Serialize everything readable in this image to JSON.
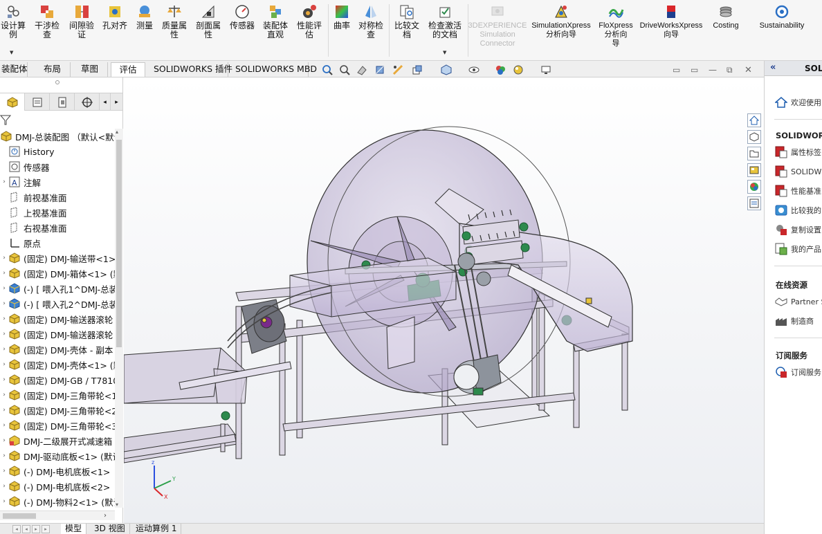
{
  "ribbon": {
    "buttons": [
      {
        "label": "设计算\n例",
        "icon": "design-study-icon"
      },
      {
        "label": "干涉检\n查",
        "icon": "interference-icon"
      },
      {
        "label": "间隙验\n证",
        "icon": "clearance-icon"
      },
      {
        "label": "孔对齐",
        "icon": "hole-align-icon"
      },
      {
        "label": "测量",
        "icon": "measure-icon"
      },
      {
        "label": "质量属\n性",
        "icon": "mass-properties-icon"
      },
      {
        "label": "剖面属\n性",
        "icon": "section-properties-icon"
      },
      {
        "label": "传感器",
        "icon": "sensor-icon"
      },
      {
        "label": "装配体\n直观",
        "icon": "assembly-visualization-icon"
      },
      {
        "label": "性能评\n估",
        "icon": "performance-icon"
      },
      {
        "label": "曲率",
        "icon": "curvature-icon"
      },
      {
        "label": "对称检\n查",
        "icon": "symmetry-icon"
      },
      {
        "label": "比较文\n档",
        "icon": "compare-icon"
      },
      {
        "label": "检查激活\n的文档",
        "icon": "check-active-icon"
      },
      {
        "label": "3DEXPERIENCE\nSimulation\nConnector",
        "icon": "3dexperience-icon"
      },
      {
        "label": "SimulationXpress\n分析向导",
        "icon": "simulationxpress-icon"
      },
      {
        "label": "FloXpress\n分析向\n导",
        "icon": "floxpress-icon"
      },
      {
        "label": "DriveWorksXpress\n向导",
        "icon": "driveworks-icon"
      },
      {
        "label": "Costing",
        "icon": "costing-icon"
      },
      {
        "label": "Sustainability",
        "icon": "sustainability-icon"
      }
    ]
  },
  "tabs": [
    "装配体",
    "布局",
    "草图",
    "评估",
    "SOLIDWORKS 插件",
    "SOLIDWORKS MBD"
  ],
  "active_tab": "评估",
  "tree": {
    "root": "DMJ-总装配图 （默认<默认",
    "items": [
      {
        "label": "History",
        "icon": "history-icon",
        "caret": ""
      },
      {
        "label": "传感器",
        "icon": "sensor-folder-icon",
        "caret": ""
      },
      {
        "label": "注解",
        "icon": "annotation-icon",
        "caret": "›"
      },
      {
        "label": "前视基准面",
        "icon": "plane-icon",
        "caret": ""
      },
      {
        "label": "上视基准面",
        "icon": "plane-icon",
        "caret": ""
      },
      {
        "label": "右视基准面",
        "icon": "plane-icon",
        "caret": ""
      },
      {
        "label": "原点",
        "icon": "origin-icon",
        "caret": ""
      },
      {
        "label": "(固定) DMJ-输送带<1>",
        "icon": "subassembly-icon",
        "caret": "›"
      },
      {
        "label": "(固定) DMJ-箱体<1> (默",
        "icon": "subassembly-icon",
        "caret": "›"
      },
      {
        "label": "(-) [ 喂入孔1^DMJ-总装",
        "icon": "part-icon",
        "caret": "›"
      },
      {
        "label": "(-) [ 喂入孔2^DMJ-总装",
        "icon": "part-icon",
        "caret": "›"
      },
      {
        "label": "(固定) DMJ-输送器滚轮",
        "icon": "subassembly-icon",
        "caret": "›"
      },
      {
        "label": "(固定) DMJ-输送器滚轮",
        "icon": "subassembly-icon",
        "caret": "›"
      },
      {
        "label": "(固定) DMJ-壳体 - 副本",
        "icon": "subassembly-icon",
        "caret": "›"
      },
      {
        "label": "(固定) DMJ-壳体<1> (默",
        "icon": "subassembly-icon",
        "caret": "›"
      },
      {
        "label": "(固定) DMJ-GB / T7810",
        "icon": "subassembly-icon",
        "caret": "›"
      },
      {
        "label": "(固定) DMJ-三角带轮<1",
        "icon": "subassembly-icon",
        "caret": "›"
      },
      {
        "label": "(固定) DMJ-三角带轮<2",
        "icon": "subassembly-icon",
        "caret": "›"
      },
      {
        "label": "(固定) DMJ-三角带轮<3",
        "icon": "subassembly-icon",
        "caret": "›"
      },
      {
        "label": "DMJ-二级展开式减速箱",
        "icon": "assembly-icon",
        "caret": "›"
      },
      {
        "label": "DMJ-驱动底板<1> (默认",
        "icon": "subassembly-icon",
        "caret": "›"
      },
      {
        "label": "(-) DMJ-电机底板<1>",
        "icon": "subassembly-icon",
        "caret": "›"
      },
      {
        "label": "(-) DMJ-电机底板<2>",
        "icon": "subassembly-icon",
        "caret": "›"
      },
      {
        "label": "(-) DMJ-物料2<1> (默认",
        "icon": "subassembly-icon",
        "caret": "›"
      }
    ]
  },
  "bottom_tabs": [
    "模型",
    "3D 视图",
    "运动算例 1"
  ],
  "active_bottom_tab": "模型",
  "task_pane": {
    "header": "SOLIDWORKS",
    "welcome": "欢迎使用",
    "section_tools": "SOLIDWORKS",
    "tools": [
      {
        "label": "属性标签",
        "icon": "property-tab-icon"
      },
      {
        "label": "SOLIDWORKS",
        "icon": "sw-tool-icon"
      },
      {
        "label": "性能基准",
        "icon": "benchmark-icon"
      },
      {
        "label": "比较我的",
        "icon": "compare-score-icon"
      },
      {
        "label": "复制设置",
        "icon": "copy-settings-icon"
      },
      {
        "label": "我的产品",
        "icon": "my-products-icon"
      }
    ],
    "section_online": "在线资源",
    "online": [
      {
        "label": "Partner S",
        "icon": "partner-icon"
      },
      {
        "label": "制造商",
        "icon": "manufacturer-icon"
      }
    ],
    "section_sub": "订阅服务",
    "sub": [
      {
        "label": "订阅服务",
        "icon": "subscription-icon"
      }
    ]
  },
  "colors": {
    "accent_blue": "#1f5fb0",
    "machine_lavender": "#c9c0d9",
    "support_green": "#2d8a4d"
  }
}
